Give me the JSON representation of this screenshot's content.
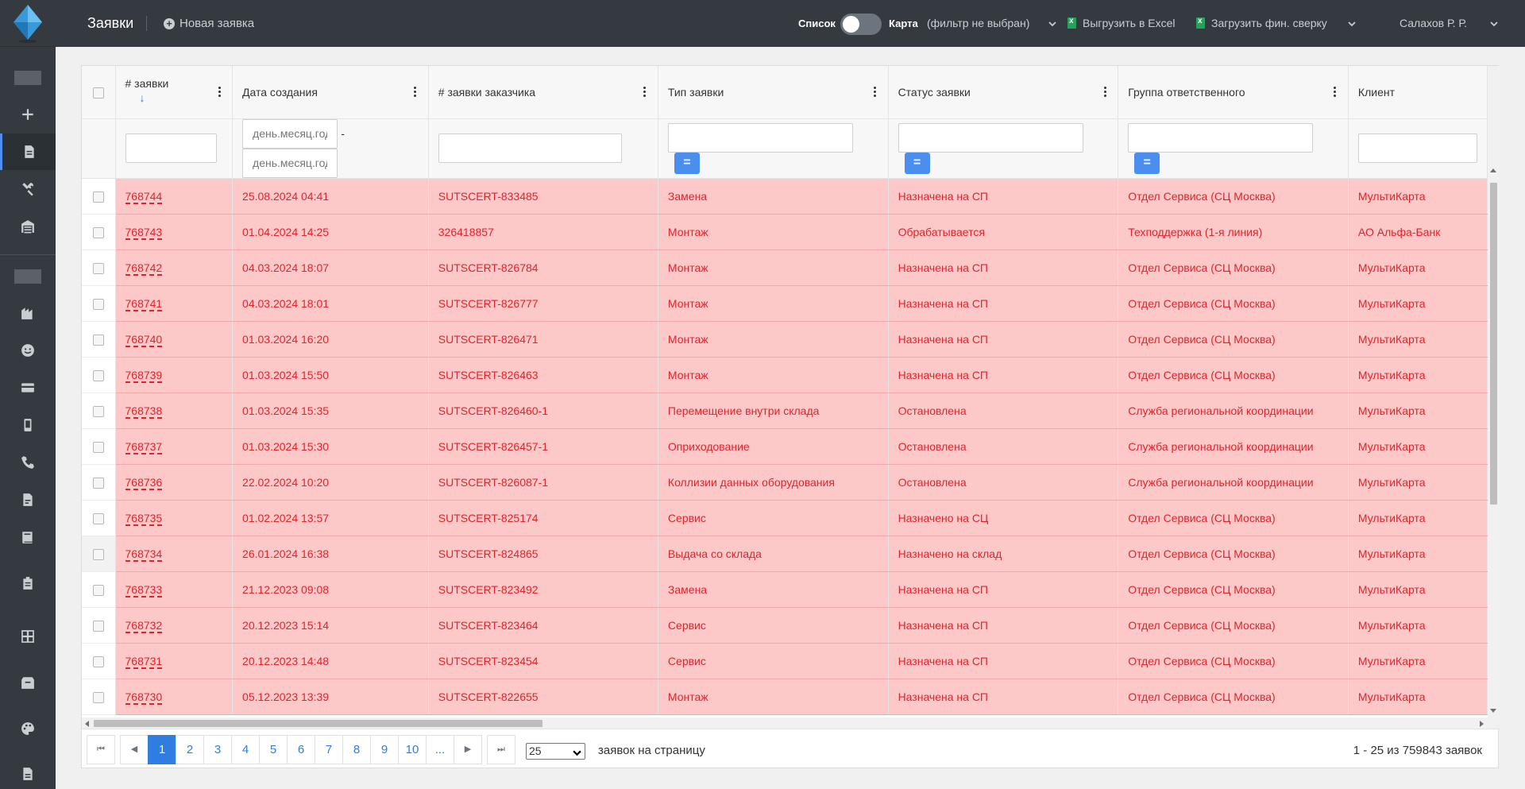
{
  "header": {
    "title": "Заявки",
    "new_request": "Новая заявка",
    "view_list": "Список",
    "view_map": "Карта",
    "filter_state": "(фильтр не выбран)",
    "export_excel": "Выгрузить в Excel",
    "upload_fin": "Загрузить фин. сверку",
    "user": "Салахов Р. Р."
  },
  "columns": {
    "number": "# заявки",
    "created": "Дата создания",
    "customer_number": "# заявки заказчика",
    "type": "Тип заявки",
    "status": "Статус заявки",
    "group": "Группа ответственного",
    "client": "Клиент"
  },
  "filters": {
    "date_from_placeholder": "день.месяц.год",
    "date_to_placeholder": "день.месяц.год",
    "eq_symbol": "=",
    "range_dash": "-"
  },
  "rows": [
    {
      "number": "768744",
      "created": "25.08.2024 04:41",
      "customer_number": "SUTSCERT-833485",
      "type": "Замена",
      "status": "Назначена на СП",
      "group": "Отдел Сервиса (СЦ Москва)",
      "client": "МультиКарта"
    },
    {
      "number": "768743",
      "created": "01.04.2024 14:25",
      "customer_number": "326418857",
      "type": "Монтаж",
      "status": "Обрабатывается",
      "group": "Техподдержка (1-я линия)",
      "client": "АО Альфа-Банк"
    },
    {
      "number": "768742",
      "created": "04.03.2024 18:07",
      "customer_number": "SUTSCERT-826784",
      "type": "Монтаж",
      "status": "Назначена на СП",
      "group": "Отдел Сервиса (СЦ Москва)",
      "client": "МультиКарта"
    },
    {
      "number": "768741",
      "created": "04.03.2024 18:01",
      "customer_number": "SUTSCERT-826777",
      "type": "Монтаж",
      "status": "Назначена на СП",
      "group": "Отдел Сервиса (СЦ Москва)",
      "client": "МультиКарта"
    },
    {
      "number": "768740",
      "created": "01.03.2024 16:20",
      "customer_number": "SUTSCERT-826471",
      "type": "Монтаж",
      "status": "Назначена на СП",
      "group": "Отдел Сервиса (СЦ Москва)",
      "client": "МультиКарта"
    },
    {
      "number": "768739",
      "created": "01.03.2024 15:50",
      "customer_number": "SUTSCERT-826463",
      "type": "Монтаж",
      "status": "Назначена на СП",
      "group": "Отдел Сервиса (СЦ Москва)",
      "client": "МультиКарта"
    },
    {
      "number": "768738",
      "created": "01.03.2024 15:35",
      "customer_number": "SUTSCERT-826460-1",
      "type": "Перемещение внутри склада",
      "status": "Остановлена",
      "group": "Служба региональной координации",
      "client": "МультиКарта"
    },
    {
      "number": "768737",
      "created": "01.03.2024 15:30",
      "customer_number": "SUTSCERT-826457-1",
      "type": "Оприходование",
      "status": "Остановлена",
      "group": "Служба региональной координации",
      "client": "МультиКарта"
    },
    {
      "number": "768736",
      "created": "22.02.2024 10:20",
      "customer_number": "SUTSCERT-826087-1",
      "type": "Коллизии данных оборудования",
      "status": "Остановлена",
      "group": "Служба региональной координации",
      "client": "МультиКарта"
    },
    {
      "number": "768735",
      "created": "01.02.2024 13:57",
      "customer_number": "SUTSCERT-825174",
      "type": "Сервис",
      "status": "Назначено на СЦ",
      "group": "Отдел Сервиса (СЦ Москва)",
      "client": "МультиКарта"
    },
    {
      "number": "768734",
      "created": "26.01.2024 16:38",
      "customer_number": "SUTSCERT-824865",
      "type": "Выдача со склада",
      "status": "Назначено на склад",
      "group": "Отдел Сервиса (СЦ Москва)",
      "client": "МультиКарта"
    },
    {
      "number": "768733",
      "created": "21.12.2023 09:08",
      "customer_number": "SUTSCERT-823492",
      "type": "Замена",
      "status": "Назначена на СП",
      "group": "Отдел Сервиса (СЦ Москва)",
      "client": "МультиКарта"
    },
    {
      "number": "768732",
      "created": "20.12.2023 15:14",
      "customer_number": "SUTSCERT-823464",
      "type": "Сервис",
      "status": "Назначена на СП",
      "group": "Отдел Сервиса (СЦ Москва)",
      "client": "МультиКарта"
    },
    {
      "number": "768731",
      "created": "20.12.2023 14:48",
      "customer_number": "SUTSCERT-823454",
      "type": "Сервис",
      "status": "Назначена на СП",
      "group": "Отдел Сервиса (СЦ Москва)",
      "client": "МультиКарта"
    },
    {
      "number": "768730",
      "created": "05.12.2023 13:39",
      "customer_number": "SUTSCERT-822655",
      "type": "Монтаж",
      "status": "Назначена на СП",
      "group": "Отдел Сервиса (СЦ Москва)",
      "client": "МультиКарта"
    }
  ],
  "pager": {
    "pages": [
      "1",
      "2",
      "3",
      "4",
      "5",
      "6",
      "7",
      "8",
      "9",
      "10",
      "..."
    ],
    "current": "1",
    "first": "⏮",
    "prev": "◀",
    "next": "▶",
    "last": "⏭",
    "per_page_value": "25",
    "per_page_label": "заявок на страницу",
    "total": "1 - 25 из 759843 заявок"
  },
  "colors": {
    "row_bg": "#fdc8c8",
    "row_text": "#e0242c",
    "accent": "#2f7de1",
    "sidebar": "#343a40"
  }
}
